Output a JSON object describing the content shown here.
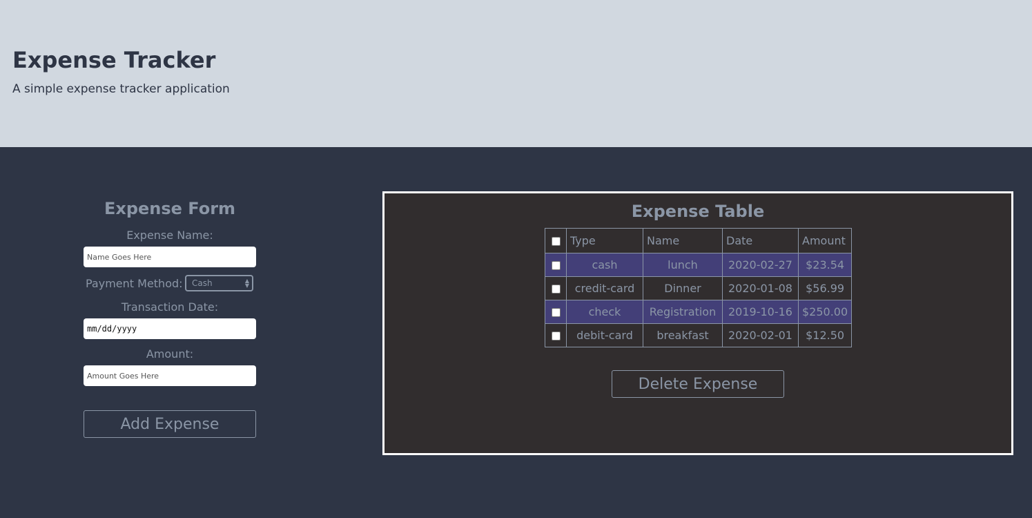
{
  "header": {
    "title": "Expense Tracker",
    "subtitle": "A simple expense tracker application"
  },
  "form": {
    "title": "Expense Form",
    "name_label": "Expense Name:",
    "name_placeholder": "Name Goes Here",
    "payment_label": "Payment Method:",
    "payment_selected": "Cash",
    "date_label": "Transaction Date:",
    "date_placeholder": "mm/dd/yyyy",
    "amount_label": "Amount:",
    "amount_placeholder": "Amount Goes Here",
    "add_button": "Add Expense"
  },
  "table": {
    "title": "Expense Table",
    "columns": [
      "Type",
      "Name",
      "Date",
      "Amount"
    ],
    "rows": [
      {
        "type": "cash",
        "name": "lunch",
        "date": "2020-02-27",
        "amount": "$23.54",
        "highlighted": true
      },
      {
        "type": "credit-card",
        "name": "Dinner",
        "date": "2020-01-08",
        "amount": "$56.99",
        "highlighted": false
      },
      {
        "type": "check",
        "name": "Registration",
        "date": "2019-10-16",
        "amount": "$250.00",
        "highlighted": true
      },
      {
        "type": "debit-card",
        "name": "breakfast",
        "date": "2020-02-01",
        "amount": "$12.50",
        "highlighted": false
      }
    ],
    "delete_button": "Delete Expense"
  },
  "colors": {
    "header_bg": "#d1d8e0",
    "main_bg": "#2e3545",
    "panel_bg": "#312d2e",
    "row_highlight": "#433f78",
    "text_muted": "#8b96a6"
  }
}
